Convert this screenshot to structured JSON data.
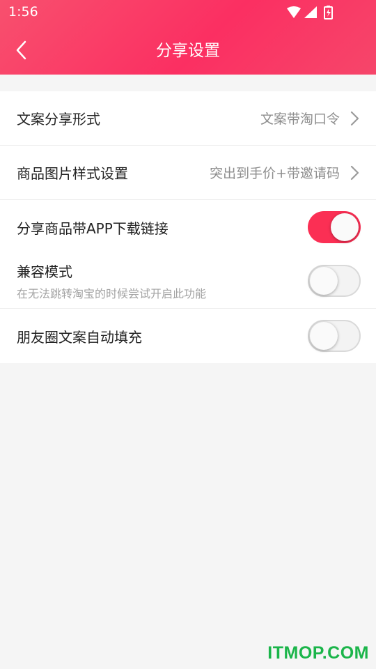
{
  "status_bar": {
    "time": "1:56"
  },
  "header": {
    "title": "分享设置"
  },
  "settings": {
    "share_format": {
      "label": "文案分享形式",
      "value": "文案带淘口令"
    },
    "image_style": {
      "label": "商品图片样式设置",
      "value": "突出到手价+带邀请码"
    },
    "app_link": {
      "label": "分享商品带APP下载链接",
      "enabled": true
    },
    "compat_mode": {
      "label": "兼容模式",
      "description": "在无法跳转淘宝的时候尝试开启此功能",
      "enabled": false
    },
    "moments_autofill": {
      "label": "朋友圈文案自动填充",
      "enabled": false
    }
  },
  "watermark": "ITMOP.COM",
  "colors": {
    "accent": "#fb2f54",
    "header": "#fb3562"
  }
}
